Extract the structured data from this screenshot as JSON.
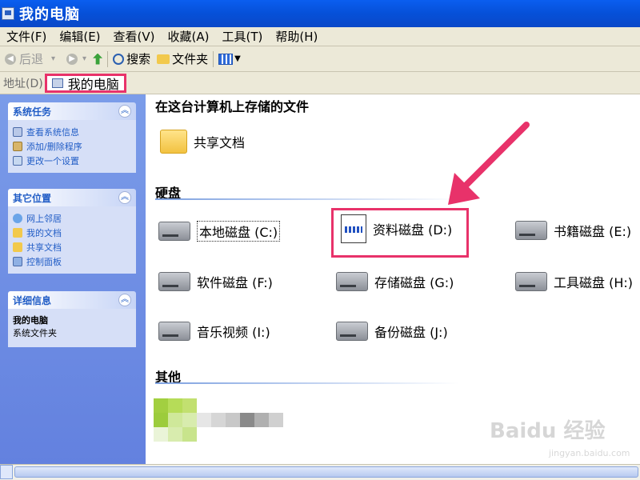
{
  "window": {
    "title": "我的电脑"
  },
  "menu": [
    "文件(F)",
    "编辑(E)",
    "查看(V)",
    "收藏(A)",
    "工具(T)",
    "帮助(H)"
  ],
  "toolbar": {
    "back": "后退",
    "search": "搜索",
    "folders": "文件夹"
  },
  "address": {
    "label": "地址(D)",
    "value": "我的电脑"
  },
  "left": {
    "system_tasks": {
      "title": "系统任务",
      "items": [
        "查看系统信息",
        "添加/删除程序",
        "更改一个设置"
      ]
    },
    "other_places": {
      "title": "其它位置",
      "items": [
        "网上邻居",
        "我的文档",
        "共享文档",
        "控制面板"
      ]
    },
    "details": {
      "title": "详细信息",
      "name": "我的电脑",
      "desc": "系统文件夹"
    }
  },
  "main": {
    "stored_heading": "在这台计算机上存储的文件",
    "shared_docs": "共享文档",
    "disk_heading": "硬盘",
    "drives": [
      "本地磁盘 (C:)",
      "资料磁盘 (D:)",
      "书籍磁盘 (E:)",
      "软件磁盘 (F:)",
      "存储磁盘 (G:)",
      "工具磁盘 (H:)",
      "音乐视频 (I:)",
      "备份磁盘 (J:)"
    ],
    "other_heading": "其他"
  },
  "watermark": {
    "brand": "Baidu 经验",
    "url": "jingyan.baidu.com"
  },
  "colors": {
    "title_bar": "#0a5ef0",
    "highlight": "#e8326a",
    "left_pane": "#6f8ee4"
  }
}
